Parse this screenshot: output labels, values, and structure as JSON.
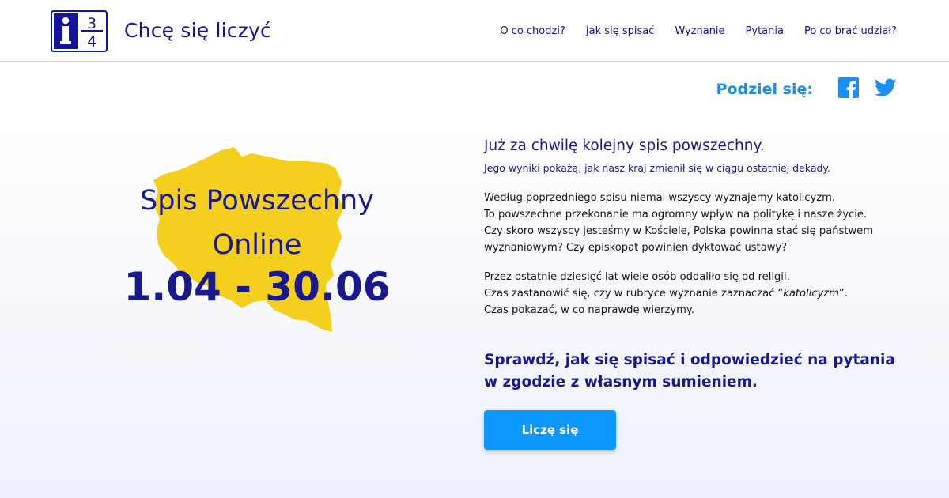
{
  "header": {
    "logo_icon": "i34-logo-icon",
    "site_title": "Chcę się liczyć",
    "nav": [
      {
        "label": "O co chodzi?"
      },
      {
        "label": "Jak się spisać"
      },
      {
        "label": "Wyznanie"
      },
      {
        "label": "Pytania"
      },
      {
        "label": "Po co brać udział?"
      }
    ]
  },
  "share": {
    "label": "Podziel się:",
    "icons": [
      "facebook-icon",
      "twitter-icon"
    ]
  },
  "hero": {
    "title_line1": "Spis Powszechny",
    "title_line2": "Online",
    "dates": "1.04 - 30.06",
    "map_icon": "poland-map-icon"
  },
  "content": {
    "headline": "Już za chwilę kolejny spis powszechny.",
    "subheadline": "Jego wyniki pokażą, jak nasz kraj zmienił się w ciągu ostatniej dekady.",
    "para1": [
      "Według poprzedniego spisu niemal wszyscy wyznajemy katolicyzm.",
      "To powszechne przekonanie ma ogromny wpływ na politykę i nasze życie.",
      "Czy skoro wszyscy jesteśmy w Kościele, Polska powinna stać się państwem",
      "wyznaniowym? Czy episkopat powinien dyktować ustawy?"
    ],
    "para2": [
      "Przez ostatnie dziesięć lat wiele osób oddaliło się od religii.",
      "Czas pokazać, w co naprawdę wierzymy."
    ],
    "para2_line2_pre": "Czas zastanowić się, czy w rubryce wyznanie zaznaczać “",
    "para2_line2_em": "katolicyzm",
    "para2_line2_post": "”.",
    "cta_heading_line1": "Sprawdź, jak się spisać i odpowiedzieć na pytania",
    "cta_heading_line2": "w zgodzie z własnym sumieniem.",
    "cta_button": "Liczę się"
  },
  "colors": {
    "brand_navy": "#18188f",
    "accent_blue": "#0b97ff",
    "map_yellow": "#f5cf1d"
  }
}
